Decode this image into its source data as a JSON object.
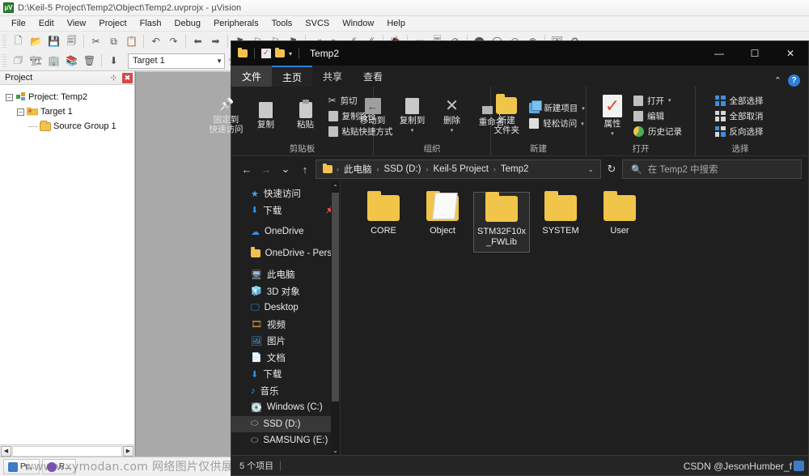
{
  "keil": {
    "title": "D:\\Keil-5 Project\\Temp2\\Object\\Temp2.uvprojx - µVision",
    "app_icon": "uvision-icon",
    "menus": [
      "File",
      "Edit",
      "View",
      "Project",
      "Flash",
      "Debug",
      "Peripherals",
      "Tools",
      "SVCS",
      "Window",
      "Help"
    ],
    "target_combo_value": "Target 1",
    "project_pane": {
      "header": "Project",
      "pin_glyph": "⊹",
      "close_glyph": "✖",
      "tree": [
        {
          "label": "Project: Temp2",
          "depth": 0,
          "expander": "-",
          "icon": "project-icon"
        },
        {
          "label": "Target 1",
          "depth": 1,
          "expander": "-",
          "icon": "target-folder-icon"
        },
        {
          "label": "Source Group 1",
          "depth": 2,
          "expander": "",
          "icon": "folder-icon"
        }
      ]
    },
    "status_tasks": [
      "Pr...",
      "R..."
    ]
  },
  "watermark": {
    "text": "www.wxymodan.com 网络图片仅供展示，非存储，如有侵权请联系删除。",
    "credit": "CSDN @JesonHumber_f"
  },
  "explorer": {
    "title": "Temp2",
    "quick_access_icons": [
      "folder-icon",
      "properties-icon",
      "new-folder-icon",
      "customize-caret-icon"
    ],
    "window_controls": {
      "minimize": "—",
      "maximize": "☐",
      "close": "✕"
    },
    "ribbon_collapse_glyph": "⌃",
    "help_glyph": "?",
    "tabs": [
      {
        "label": "文件",
        "type": "file"
      },
      {
        "label": "主页",
        "type": "active"
      },
      {
        "label": "共享",
        "type": "normal"
      },
      {
        "label": "查看",
        "type": "normal"
      }
    ],
    "ribbon": {
      "groups": [
        {
          "label": "剪贴板",
          "big_buttons": [
            {
              "label": "固定到\n快速访问",
              "icon": "pin-icon"
            },
            {
              "label": "复制",
              "icon": "copy-icon"
            },
            {
              "label": "粘贴",
              "icon": "paste-icon"
            }
          ],
          "small_buttons": [
            {
              "label": "剪切",
              "icon": "scissors-icon"
            },
            {
              "label": "复制路径",
              "icon": "copy-path-icon"
            },
            {
              "label": "粘贴快捷方式",
              "icon": "paste-shortcut-icon"
            }
          ]
        },
        {
          "label": "组织",
          "big_buttons": [
            {
              "label": "移动到",
              "icon": "move-to-icon",
              "caret": true
            },
            {
              "label": "复制到",
              "icon": "copy-to-icon",
              "caret": true
            },
            {
              "label": "删除",
              "icon": "delete-icon",
              "caret": true
            },
            {
              "label": "重命名",
              "icon": "rename-icon"
            }
          ],
          "small_buttons": []
        },
        {
          "label": "新建",
          "big_buttons": [
            {
              "label": "新建\n文件夹",
              "icon": "new-folder-icon"
            }
          ],
          "small_buttons": [
            {
              "label": "新建项目",
              "icon": "new-item-icon",
              "caret": true
            },
            {
              "label": "轻松访问",
              "icon": "easy-access-icon",
              "caret": true
            }
          ]
        },
        {
          "label": "打开",
          "big_buttons": [
            {
              "label": "属性",
              "icon": "properties-icon",
              "caret": true
            }
          ],
          "small_buttons": [
            {
              "label": "打开",
              "icon": "open-icon",
              "caret": true
            },
            {
              "label": "编辑",
              "icon": "edit-icon"
            },
            {
              "label": "历史记录",
              "icon": "history-icon"
            }
          ]
        },
        {
          "label": "选择",
          "big_buttons": [],
          "small_buttons": [
            {
              "label": "全部选择",
              "icon": "select-all-icon"
            },
            {
              "label": "全部取消",
              "icon": "select-none-icon"
            },
            {
              "label": "反向选择",
              "icon": "invert-selection-icon"
            }
          ]
        }
      ]
    },
    "address": {
      "back_glyph": "←",
      "forward_glyph": "→",
      "recent_glyph": "⌄",
      "up_glyph": "↑",
      "crumbs": [
        "此电脑",
        "SSD (D:)",
        "Keil-5 Project",
        "Temp2"
      ],
      "separator": "›",
      "dropdown_glyph": "⌄",
      "refresh_glyph": "↻"
    },
    "search": {
      "icon": "search-icon",
      "placeholder": "在 Temp2 中搜索"
    },
    "nav_pane": {
      "items": [
        {
          "label": "快速访问",
          "icon": "star-icon",
          "indent": 0,
          "pinned": false,
          "selected": false
        },
        {
          "label": "下载",
          "icon": "download-icon",
          "indent": 1,
          "pinned": true,
          "selected": false
        },
        {
          "label": "OneDrive",
          "icon": "cloud-icon",
          "indent": 0,
          "pinned": false,
          "selected": false
        },
        {
          "label": "OneDrive - Perso",
          "icon": "folder-icon",
          "indent": 0,
          "pinned": false,
          "selected": false
        },
        {
          "label": "此电脑",
          "icon": "pc-icon",
          "indent": 0,
          "pinned": false,
          "selected": false
        },
        {
          "label": "3D 对象",
          "icon": "3d-objects-icon",
          "indent": 1,
          "pinned": false,
          "selected": false
        },
        {
          "label": "Desktop",
          "icon": "desktop-icon",
          "indent": 1,
          "pinned": false,
          "selected": false
        },
        {
          "label": "视频",
          "icon": "videos-icon",
          "indent": 1,
          "pinned": false,
          "selected": false
        },
        {
          "label": "图片",
          "icon": "pictures-icon",
          "indent": 1,
          "pinned": false,
          "selected": false
        },
        {
          "label": "文档",
          "icon": "documents-icon",
          "indent": 1,
          "pinned": false,
          "selected": false
        },
        {
          "label": "下载",
          "icon": "download-icon",
          "indent": 1,
          "pinned": false,
          "selected": false
        },
        {
          "label": "音乐",
          "icon": "music-icon",
          "indent": 1,
          "pinned": false,
          "selected": false
        },
        {
          "label": "Windows (C:)",
          "icon": "drive-icon",
          "indent": 1,
          "pinned": false,
          "selected": false
        },
        {
          "label": "SSD (D:)",
          "icon": "disk-icon",
          "indent": 1,
          "pinned": false,
          "selected": true
        },
        {
          "label": "SAMSUNG (E:)",
          "icon": "disk-icon",
          "indent": 1,
          "pinned": false,
          "selected": false
        }
      ],
      "scroll_up_glyph": "⌃",
      "scroll_down_glyph": "⌄"
    },
    "files": [
      {
        "name": "CORE",
        "type": "folder",
        "selected": false
      },
      {
        "name": "Object",
        "type": "folder-open",
        "selected": false
      },
      {
        "name": "STM32F10x_FWLib",
        "type": "folder",
        "selected": true
      },
      {
        "name": "SYSTEM",
        "type": "folder",
        "selected": false
      },
      {
        "name": "User",
        "type": "folder",
        "selected": false
      }
    ],
    "status": {
      "count_text": "5 个项目"
    }
  }
}
